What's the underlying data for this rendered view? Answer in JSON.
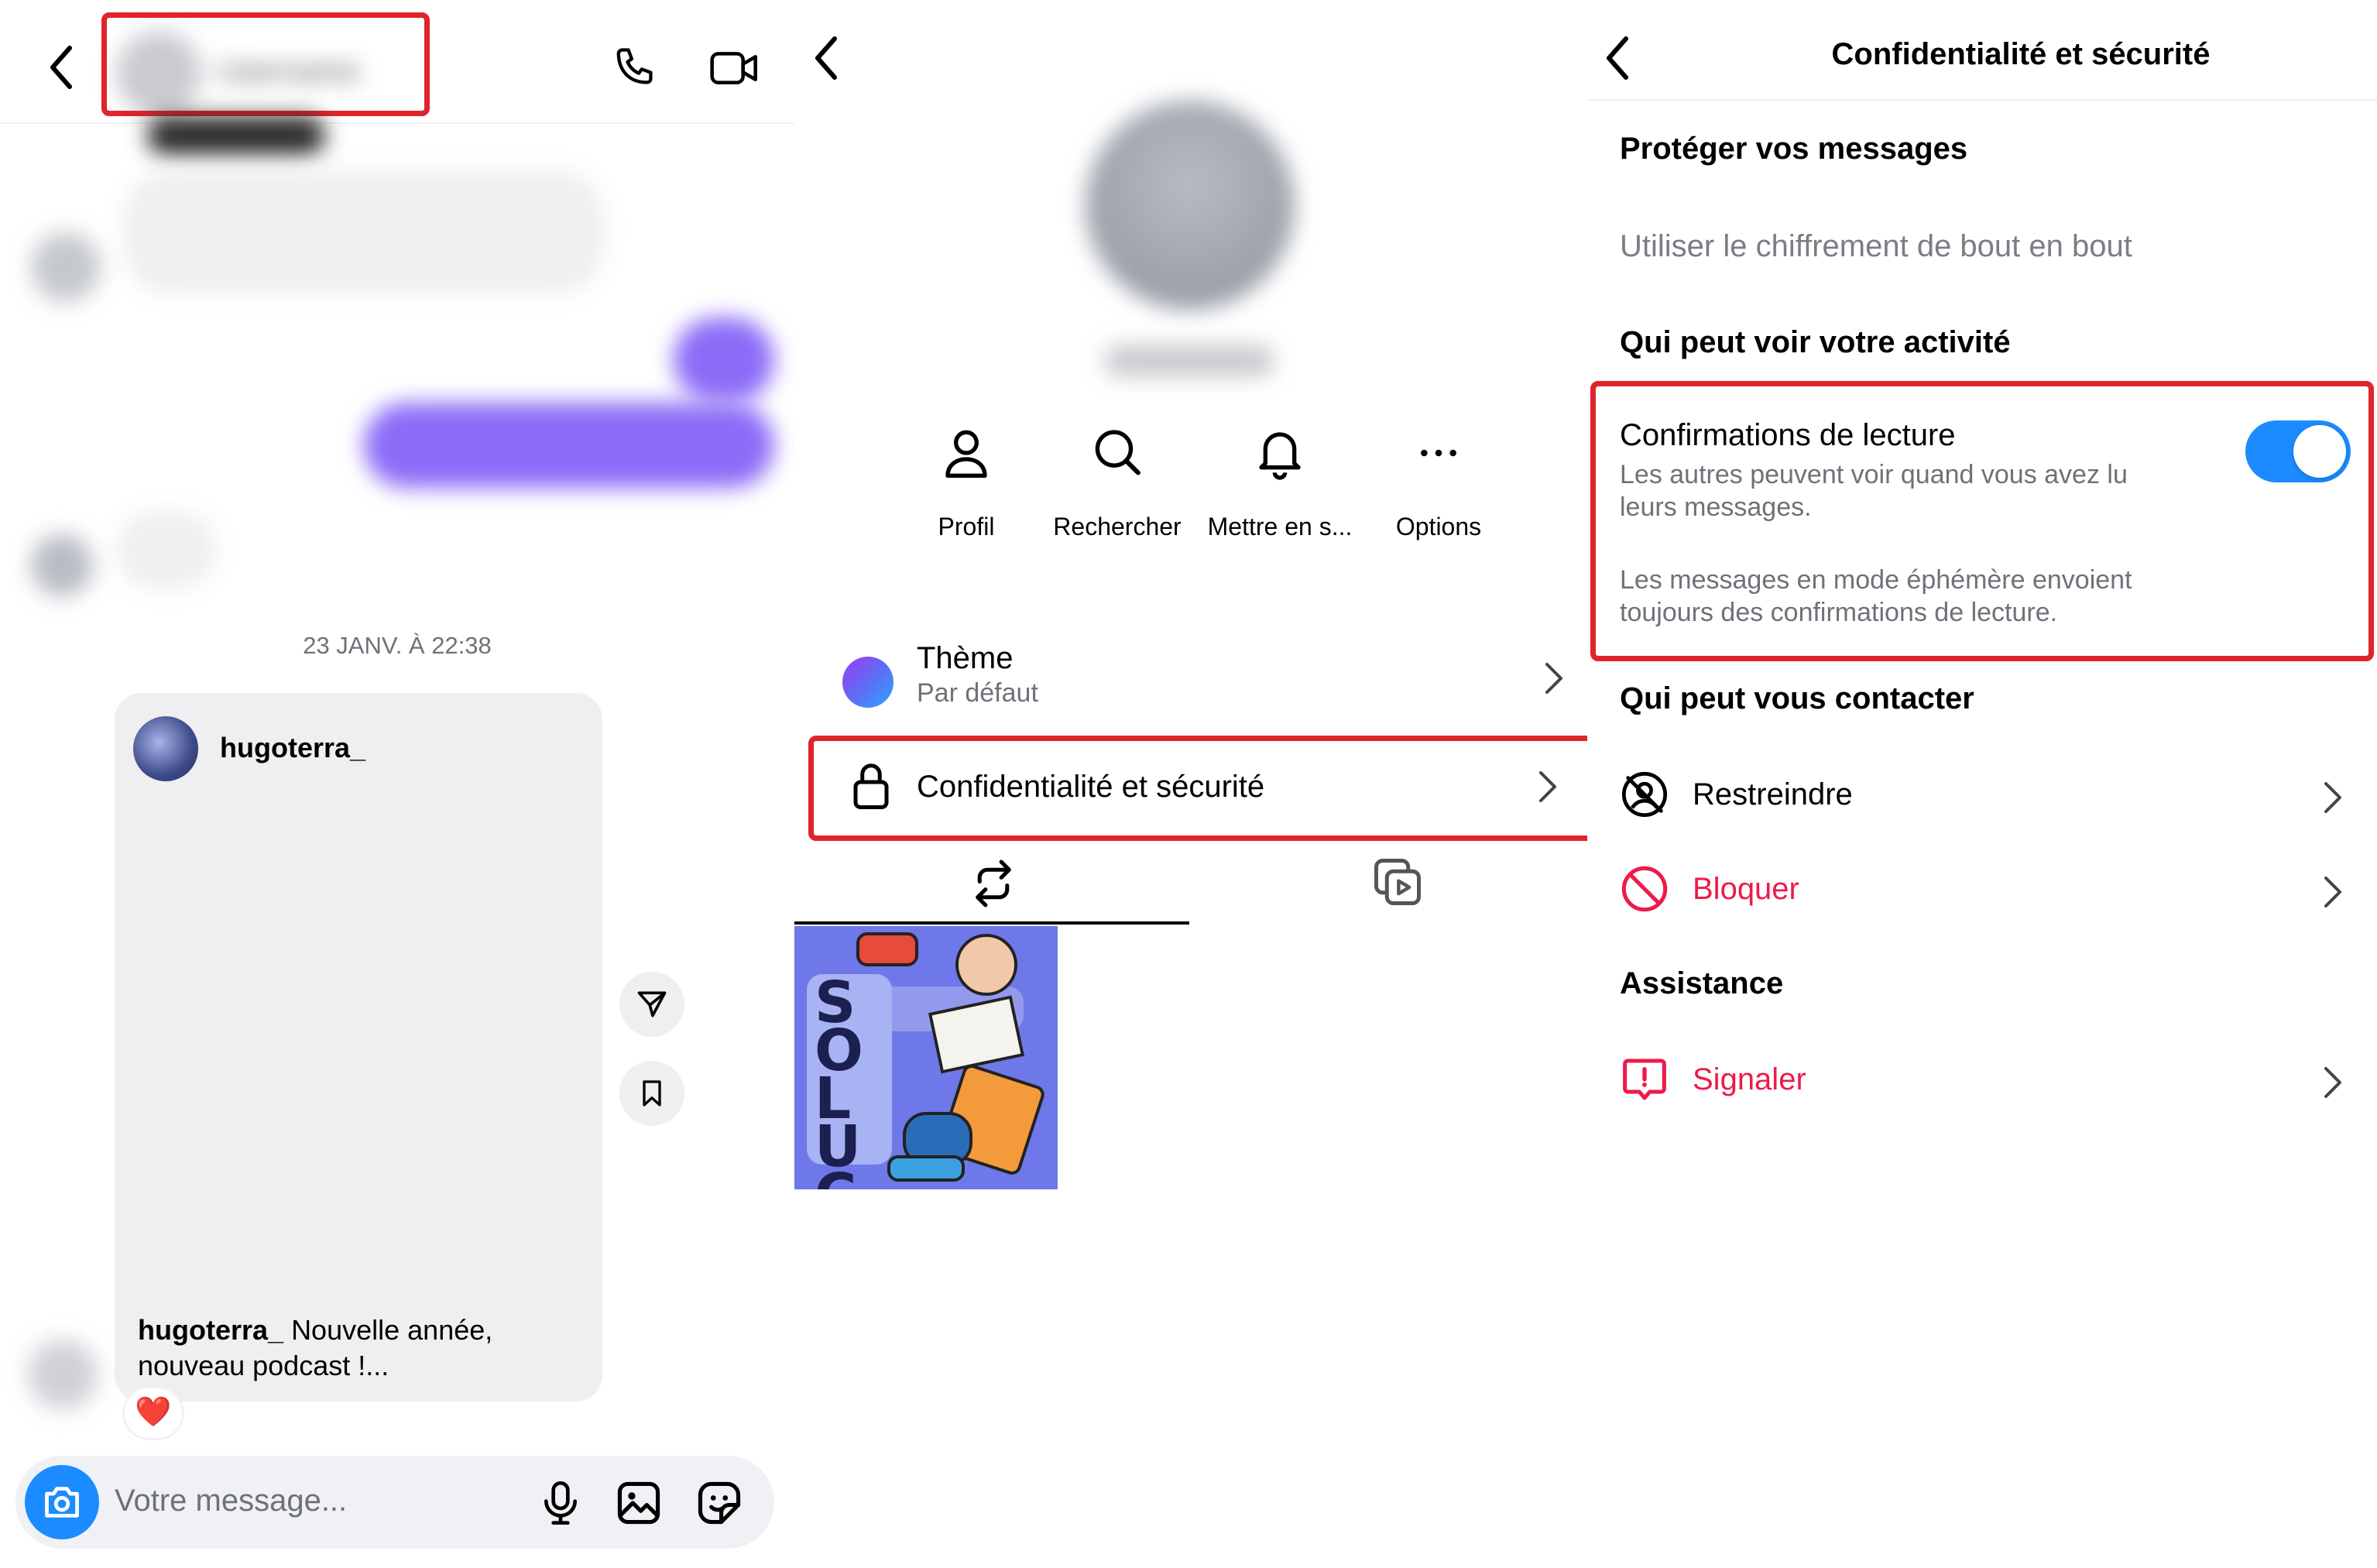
{
  "colors": {
    "accent_blue": "#1a8cff",
    "danger_red": "#ed1a4a",
    "highlight_red": "#e0242b",
    "bubble_purple": "#8c6cf7",
    "gray_bubble": "#efeff2",
    "secondary_text": "#6e7178"
  },
  "chat": {
    "header": {
      "back_icon": "chevron-left-icon",
      "contact_name": "Username",
      "call_icon": "phone-icon",
      "video_icon": "video-camera-icon"
    },
    "timestamp": "23 JANV. À 22:38",
    "shared_post": {
      "author": "hugoterra_",
      "caption_author": "hugoterra_",
      "caption_text": "Nouvelle année, nouveau podcast !...",
      "reaction": "❤️",
      "share_icon": "send-icon",
      "save_icon": "bookmark-icon"
    },
    "composer": {
      "camera_icon": "camera-icon",
      "placeholder": "Votre message...",
      "mic_icon": "microphone-icon",
      "gallery_icon": "image-icon",
      "sticker_icon": "sticker-icon"
    }
  },
  "details": {
    "back_icon": "chevron-left-icon",
    "username": "Username",
    "actions": [
      {
        "label": "Profil",
        "icon": "person-icon"
      },
      {
        "label": "Rechercher",
        "icon": "search-icon"
      },
      {
        "label": "Mettre en s...",
        "icon": "bell-icon"
      },
      {
        "label": "Options",
        "icon": "more-icon"
      }
    ],
    "theme": {
      "title": "Thème",
      "subtitle": "Par défaut"
    },
    "privacy": {
      "title": "Confidentialité et sécurité"
    },
    "tabs": [
      {
        "name": "tab-shared-posts",
        "icon": "repost-icon"
      },
      {
        "name": "tab-media",
        "icon": "media-icon"
      }
    ],
    "thumbnail_text": "SOLUCE"
  },
  "privacy": {
    "title": "Confidentialité et sécurité",
    "section_protect": "Protéger vos messages",
    "encryption_label": "Utiliser le chiffrement de bout en bout",
    "section_activity": "Qui peut voir votre activité",
    "read_receipts": {
      "title": "Confirmations de lecture",
      "line1": "Les autres peuvent voir quand vous avez lu",
      "line2": "leurs messages.",
      "note1": "Les messages en mode éphémère envoient",
      "note2": "toujours des confirmations de lecture.",
      "enabled": true
    },
    "section_contact": "Qui peut vous contacter",
    "restrict": "Restreindre",
    "block": "Bloquer",
    "section_support": "Assistance",
    "report": "Signaler"
  }
}
